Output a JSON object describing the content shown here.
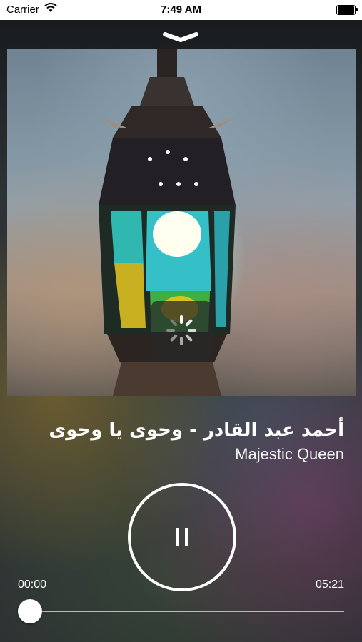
{
  "status_bar": {
    "carrier": "Carrier",
    "time": "7:49 AM"
  },
  "player": {
    "title": "أحمد عبد القادر   - وحوى يا وحوى",
    "artist": "Majestic Queen",
    "elapsed": "00:00",
    "duration": "05:21",
    "progress": 0.0,
    "state": "paused",
    "loading": true
  },
  "icons": {
    "collapse": "chevron-down-icon",
    "playback": "pause-icon",
    "wifi": "wifi-icon",
    "battery": "battery-icon"
  }
}
